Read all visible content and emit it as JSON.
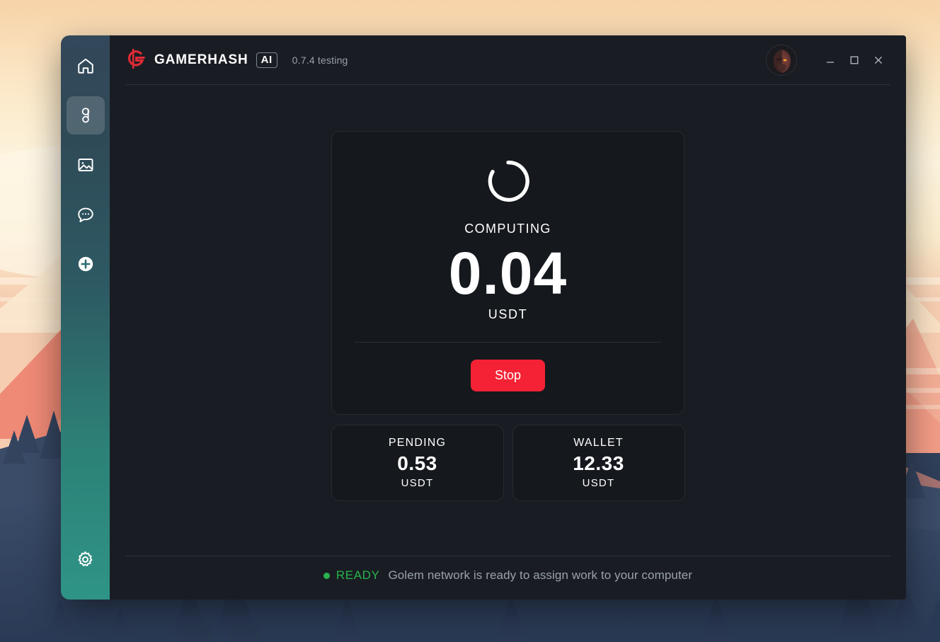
{
  "window": {
    "brand_name": "GAMERHASH",
    "ai_badge": "AI",
    "version": "0.7.4 testing",
    "logo_icon": "gamerhash-g-logo-icon",
    "avatar_alt": "user-avatar",
    "controls": {
      "minimize": "minimize-icon",
      "maximize": "maximize-icon",
      "close": "close-icon"
    }
  },
  "sidebar": {
    "items": [
      {
        "name": "home",
        "icon": "home-icon",
        "active": false
      },
      {
        "name": "golem",
        "icon": "golem-g-icon",
        "active": true
      },
      {
        "name": "images",
        "icon": "image-icon",
        "active": false
      },
      {
        "name": "chat",
        "icon": "chat-bubble-icon",
        "active": false
      },
      {
        "name": "add",
        "icon": "plus-circle-icon",
        "active": false
      }
    ],
    "bottom": {
      "name": "settings",
      "icon": "gear-icon"
    }
  },
  "compute": {
    "spinner_icon": "loading-spinner-icon",
    "status_label": "COMPUTING",
    "amount": "0.04",
    "unit": "USDT",
    "stop_label": "Stop",
    "stop_color": "#f42234"
  },
  "stats": [
    {
      "title": "PENDING",
      "value": "0.53",
      "unit": "USDT"
    },
    {
      "title": "WALLET",
      "value": "12.33",
      "unit": "USDT"
    }
  ],
  "footer": {
    "state": "READY",
    "state_color": "#2bb24c",
    "message": "Golem network is ready to assign work to your computer"
  }
}
